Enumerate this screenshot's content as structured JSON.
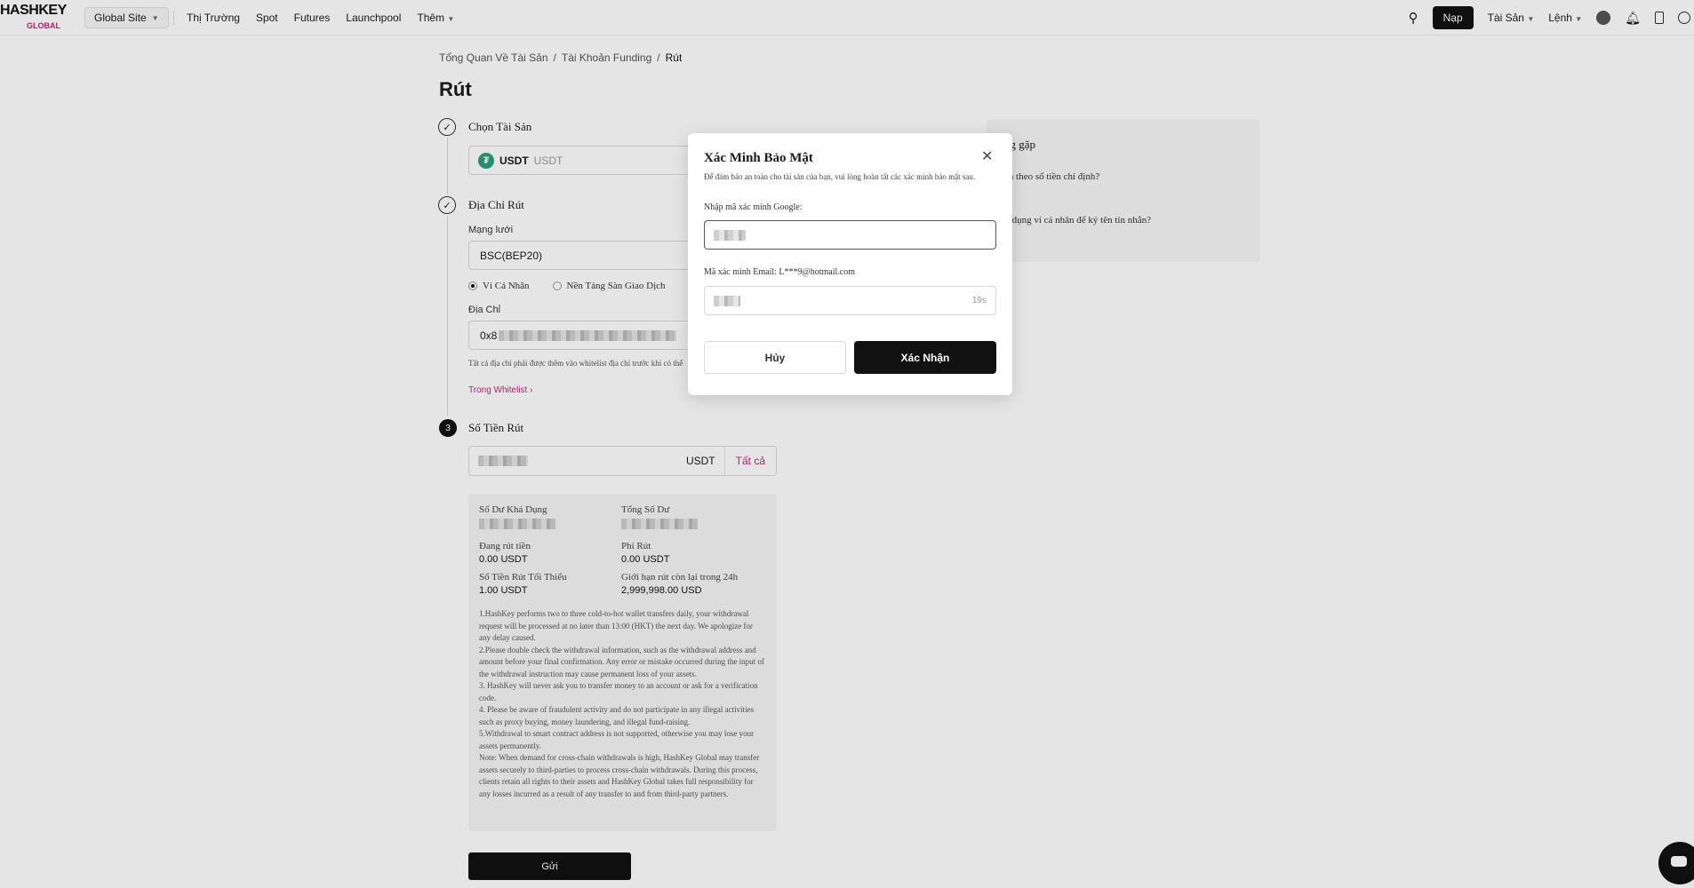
{
  "header": {
    "logo_text": "HASHKEY",
    "logo_sub": "GLOBAL",
    "site_selector": "Global Site",
    "nav": [
      "Thị Trường",
      "Spot",
      "Futures",
      "Launchpool",
      "Thêm"
    ],
    "deposit": "Nạp",
    "assets": "Tài Sản",
    "orders": "Lệnh"
  },
  "breadcrumb": [
    "Tổng Quan Về Tài Sản",
    "Tài Khoản Funding",
    "Rút"
  ],
  "page_title": "Rút",
  "step1": {
    "title": "Chọn Tài Sản",
    "coin_symbol": "USDT",
    "coin_name": "USDT"
  },
  "step2": {
    "title": "Địa Chỉ Rút",
    "network_label": "Mạng lưới",
    "network_value": "BSC(BEP20)",
    "radio_personal": "Ví Cá Nhân",
    "radio_exchange": "Nền Tảng Sàn Giao Dịch",
    "address_label": "Địa Chỉ",
    "address_prefix": "0x8",
    "whitelist_hint": "Tất cả địa chỉ phải được thêm vào whitelist địa chỉ trước khi có thể",
    "whitelist_link": "Trong Whitelist"
  },
  "step3": {
    "number": "3",
    "title": "Số Tiền Rút",
    "unit": "USDT",
    "all": "Tất cả"
  },
  "info": {
    "available_label": "Số Dư Khả Dụng",
    "total_label": "Tổng Số Dư",
    "withdrawing_label": "Đang rút tiền",
    "withdrawing_value": "0.00 USDT",
    "fee_label": "Phí Rút",
    "fee_value": "0.00 USDT",
    "min_label": "Số Tiền Rút Tối Thiểu",
    "min_value": "1.00 USDT",
    "limit_label": "Giới hạn rút còn lại trong 24h",
    "limit_value": "2,999,998.00 USD",
    "notes": [
      "1.HashKey performs two to three cold-to-hot wallet transfers daily, your withdrawal request will be processed at no later than 13:00 (HKT) the next day. We apologize for any delay caused.",
      "2.Please double check the withdrawal information, such as the withdrawal address and amount before your final confirmation. Any error or mistake occurred during the input of the withdrawal instruction may cause permanent loss of your assets.",
      "3. HashKey will never ask you to transfer money to an account or ask for a verification code.",
      "4. Please be aware of fraudulent activity and do not participate in any illegal activities such as proxy buying, money laundering, and illegal fund-raising.",
      "5.Withdrawal to smart contract address is not supported, otherwise you may lose your assets permanently.",
      "Note:  When demand for cross-chain withdrawals is high, HashKey Global may transfer assets securely to third-parties to process cross-chain withdrawals. During this process, clients retain all rights to their assets and HashKey Global takes full responsibility for any losses incurred as a result of any transfer to and from third-party partners."
    ]
  },
  "submit": "Gửi",
  "faq": {
    "title_fragment": "ng gặp",
    "item1": "ền theo số tiền chỉ định?",
    "item2": "ợ dụng ví cá nhân để ký tên tin nhắn?"
  },
  "modal": {
    "title": "Xác Minh Bảo Mật",
    "description": "Để đảm bảo an toàn cho tài sản của bạn, vui lòng hoàn tất các xác minh bảo mật sau.",
    "google_label": "Nhập mã xác minh Google:",
    "email_label": "Mã xác minh Email: L***9@hotmail.com",
    "countdown": "19s",
    "cancel": "Hủy",
    "confirm": "Xác Nhận"
  }
}
